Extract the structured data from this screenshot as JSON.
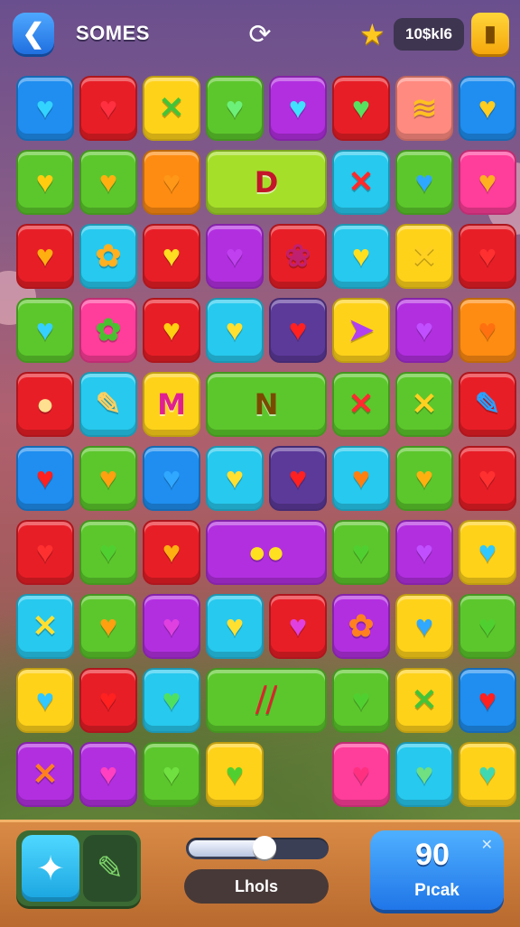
{
  "header": {
    "title": "SOMES",
    "score": "10$kl6",
    "back_icon": "arrow-left-icon",
    "center_icon": "refresh-icon",
    "star_icon": "star-icon",
    "coin_icon": "coin-icon"
  },
  "bottom": {
    "slider_level": 0.55,
    "levels_label": "Lhols",
    "pick_count": "90",
    "pick_label": "Pıcak",
    "left_tile_icon": "star-icon",
    "right_tile_icon": "pencil-icon"
  },
  "colors": {
    "blue": "#1f8ef0",
    "red": "#e81e27",
    "yellow": "#ffd21a",
    "green": "#5cc72c",
    "lime": "#a6df2a",
    "purple": "#b22fe0",
    "pink": "#ff3d9a",
    "cyan": "#27c9ee",
    "orange": "#ff8c12",
    "violet": "#5c3a9a",
    "salmon": "#ff8a80"
  },
  "board": {
    "rows": [
      [
        "blue:♥:#33d3ff",
        "red:♥:#ff3040",
        "yellow:✕:#45c338",
        "green:♥:#6cf07a",
        "purple:♥:#40e0ff",
        "red:♥:#58e060",
        "salmon:≋:#ffc020",
        "blue:♥:#ffcc20"
      ],
      [
        "green:♥:#ffcc10",
        "green:♥:#ffb010",
        "orange:♥:#ff9818",
        "lime-wide:D:#c3162a",
        "cyan:✕:#ff2a2a",
        "green:♥:#2ea8ff",
        "pink:♥:#ffb020"
      ],
      [
        "red:♥:#ffb010",
        "cyan:✿:#ffb020",
        "red:♥:#ffdd20",
        "purple:♥:#c040f0",
        "red:❀:#c02070",
        "cyan:♥:#ffe020",
        "yellow:✕:#ffd020",
        "red:♥:#ff3030"
      ],
      [
        "green:♥:#35d0ff",
        "pink:✿:#4ac030",
        "red:♥:#ffd010",
        "cyan:♥:#ffe030",
        "violet:♥:#ff2020",
        "yellow:➤:#b040f0",
        "purple:♥:#c050ff",
        "orange:♥:#ff7010"
      ],
      [
        "red:●:#ffe090",
        "cyan:✎:#ffd060",
        "yellow:M:#e02090",
        "green-wide:N:#7a4a00",
        "green:✕:#ff2a30",
        "green:✕:#ffd020",
        "red:✎:#2aa0ff"
      ],
      [
        "blue:♥:#ff2020",
        "green:♥:#ffa010",
        "blue:♥:#30a8ff",
        "cyan:♥:#ffe030",
        "violet:♥:#ff2020",
        "cyan:♥:#ff8010",
        "green:♥:#ffb010",
        "red:♥:#ff3030"
      ],
      [
        "red:♥:#ff3030",
        "green:♥:#50d030",
        "red:♥:#ffb010",
        "purple-wide:●●:#ffe020",
        "green:♥:#50d030",
        "purple:♥:#c050ff",
        "yellow:♥:#30c8ff"
      ],
      [
        "cyan:✕:#ffe030",
        "green:♥:#ffa010",
        "purple:♥:#e040e0",
        "cyan:♥:#ffe030",
        "red:♥:#e040e0",
        "purple:✿:#ff8020",
        "yellow:♥:#30a8ff",
        "green:♥:#50d030"
      ],
      [
        "yellow:♥:#30c8ff",
        "red:♥:#ff2020",
        "cyan:♥:#50e060",
        "green-wide:⧸⧸:#e02030",
        "green:♥:#50d030",
        "yellow:✕:#45c338",
        "blue:♥:#ff2020"
      ],
      [
        "purple:✕:#ff8020",
        "purple:♥:#ff40c0",
        "green:♥:#70e040",
        "yellow:♥:#50d030",
        "gap",
        "pink:♥:#ff3080",
        "cyan:♥:#70e080",
        "yellow:♥:#40d8b0"
      ]
    ]
  }
}
